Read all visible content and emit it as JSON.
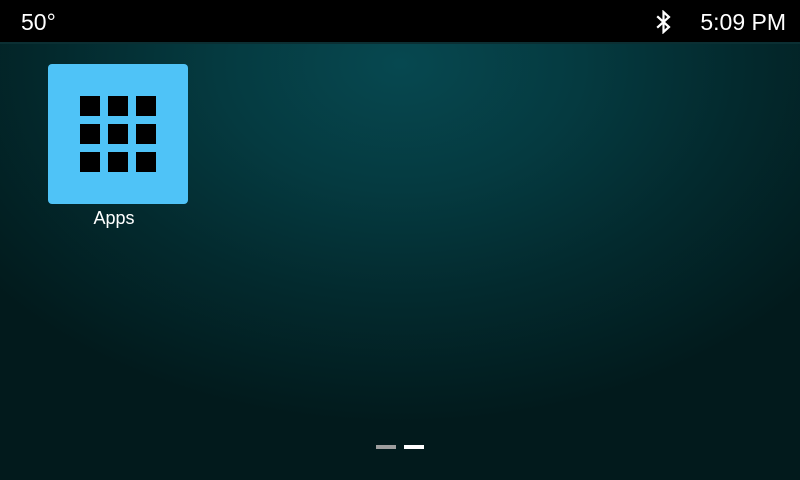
{
  "status_bar": {
    "temperature": "50°",
    "bluetooth_icon": "bluetooth-icon",
    "time": "5:09 PM"
  },
  "home": {
    "apps": [
      {
        "label": "Apps",
        "icon": "apps-grid-icon",
        "icon_color": "#4fc3f7"
      }
    ]
  },
  "page_indicator": {
    "pages": 2,
    "current_page": 2
  },
  "colors": {
    "status_bar_bg": "#000000",
    "desktop_bg": "#053a40",
    "app_tile": "#4fc3f7"
  }
}
